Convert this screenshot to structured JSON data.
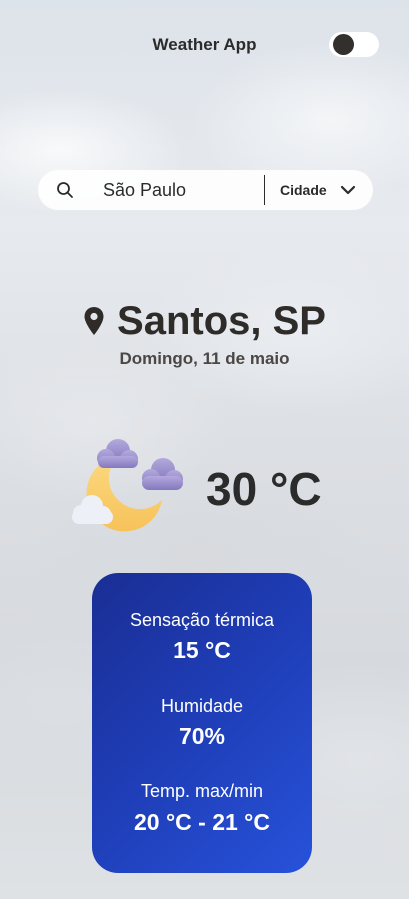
{
  "header": {
    "title": "Weather App",
    "theme_toggle": {
      "state": "off"
    }
  },
  "search": {
    "value": "São Paulo",
    "placeholder": "",
    "mode": "Cidade",
    "icon": "search-icon",
    "dropdown_icon": "chevron-down-icon"
  },
  "location": {
    "city": "Santos, SP",
    "date": "Domingo, 11 de maio",
    "icon": "location-pin-icon"
  },
  "current": {
    "temperature": "30 °C",
    "condition_icon": "partly-cloudy-night-icon"
  },
  "details": {
    "feels_like_label": "Sensação térmica",
    "feels_like_value": "15 °C",
    "humidity_label": "Humidade",
    "humidity_value": "70%",
    "minmax_label": "Temp. max/min",
    "minmax_value": "20 °C - 21 °C"
  },
  "colors": {
    "card_gradient_start": "#1a2e94",
    "card_gradient_end": "#2752da",
    "text_dark": "#2b2b2b",
    "moon": "#f9cc6b",
    "cloud_purple": "#9a8fc9"
  }
}
